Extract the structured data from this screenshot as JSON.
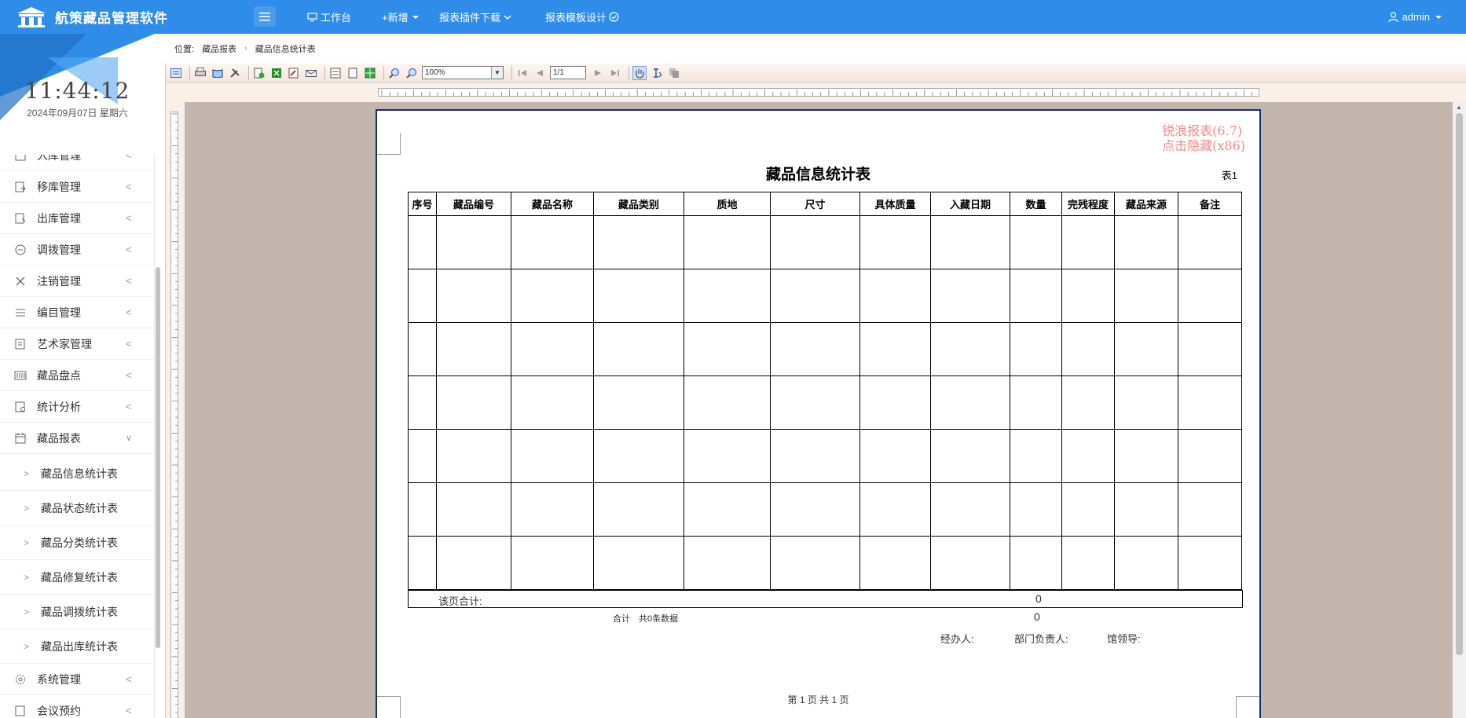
{
  "app": {
    "title": "航策藏品管理软件"
  },
  "topnav": {
    "workbench": "工作台",
    "add": "+新增",
    "plugin_download": "报表插件下载",
    "template_design": "报表模板设计"
  },
  "user": {
    "name": "admin"
  },
  "clock": {
    "time": "11:44:12",
    "date": "2024年09月07日 星期六"
  },
  "sidebar": {
    "items": [
      {
        "label": "入库管理",
        "icon": "box-in-icon"
      },
      {
        "label": "移库管理",
        "icon": "transfer-icon"
      },
      {
        "label": "出库管理",
        "icon": "box-out-icon"
      },
      {
        "label": "调拨管理",
        "icon": "swap-icon"
      },
      {
        "label": "注销管理",
        "icon": "close-icon"
      },
      {
        "label": "编目管理",
        "icon": "list-icon"
      },
      {
        "label": "艺术家管理",
        "icon": "artist-icon"
      },
      {
        "label": "藏品盘点",
        "icon": "inventory-icon"
      },
      {
        "label": "统计分析",
        "icon": "stats-icon"
      },
      {
        "label": "藏品报表",
        "icon": "calendar-icon"
      }
    ],
    "report_sub": [
      "藏品信息统计表",
      "藏品状态统计表",
      "藏品分类统计表",
      "藏品修复统计表",
      "藏品调拨统计表",
      "藏品出库统计表"
    ],
    "bottom": [
      {
        "label": "系统管理",
        "icon": "gear-icon"
      },
      {
        "label": "会议预约",
        "icon": "meeting-icon"
      }
    ]
  },
  "breadcrumb": {
    "prefix": "位置:",
    "level1": "藏品报表",
    "level2": "藏品信息统计表"
  },
  "viewer": {
    "zoom": "100%",
    "page": "1/1"
  },
  "report": {
    "watermark_line1": "锐浪报表(6.7)",
    "watermark_line2": "点击隐藏(x86)",
    "title": "藏品信息统计表",
    "tag": "表1",
    "columns": [
      "序号",
      "藏品编号",
      "藏品名称",
      "藏品类别",
      "质地",
      "尺寸",
      "具体质量",
      "入藏日期",
      "数量",
      "完残程度",
      "藏品来源",
      "备注"
    ],
    "page_total_label": "该页合计:",
    "page_total_value": "0",
    "grand_total_label": "合计　共0条数据",
    "grand_total_value": "0",
    "sign_handler": "经办人:",
    "sign_dept": "部门负责人:",
    "sign_leader": "馆领导:",
    "page_footer": "第 1 页 共 1 页"
  },
  "colors": {
    "topbar": "#2f8ce8",
    "watermark": "#f28a8a",
    "canvas": "#c4b6ae"
  }
}
